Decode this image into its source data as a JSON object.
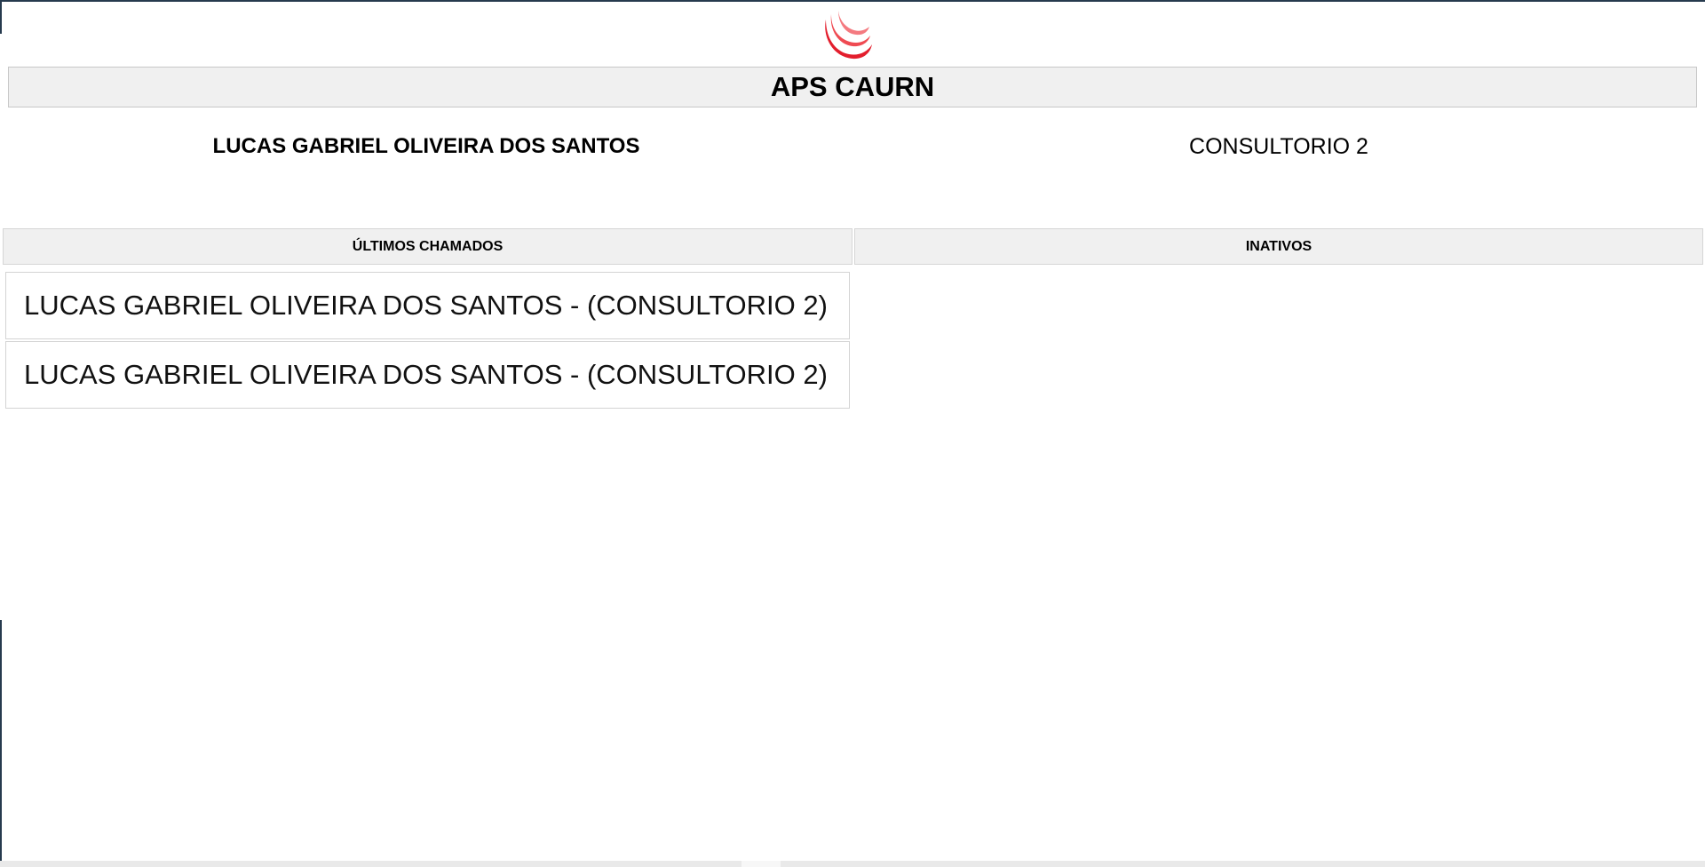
{
  "header": {
    "logo_icon": "red-swirl-logo-icon",
    "title": "APS CAURN",
    "logo_color": "#e31e2d"
  },
  "current_call": {
    "name": "LUCAS GABRIEL OLIVEIRA DOS SANTOS",
    "room": "CONSULTORIO 2"
  },
  "columns": {
    "recent_label": "ÚLTIMOS CHAMADOS",
    "inactive_label": "INATIVOS"
  },
  "recent_calls": [
    {
      "text": "LUCAS GABRIEL OLIVEIRA DOS SANTOS - (CONSULTORIO 2)"
    },
    {
      "text": "LUCAS GABRIEL OLIVEIRA DOS SANTOS - (CONSULTORIO 2)"
    }
  ],
  "inactive_calls": []
}
